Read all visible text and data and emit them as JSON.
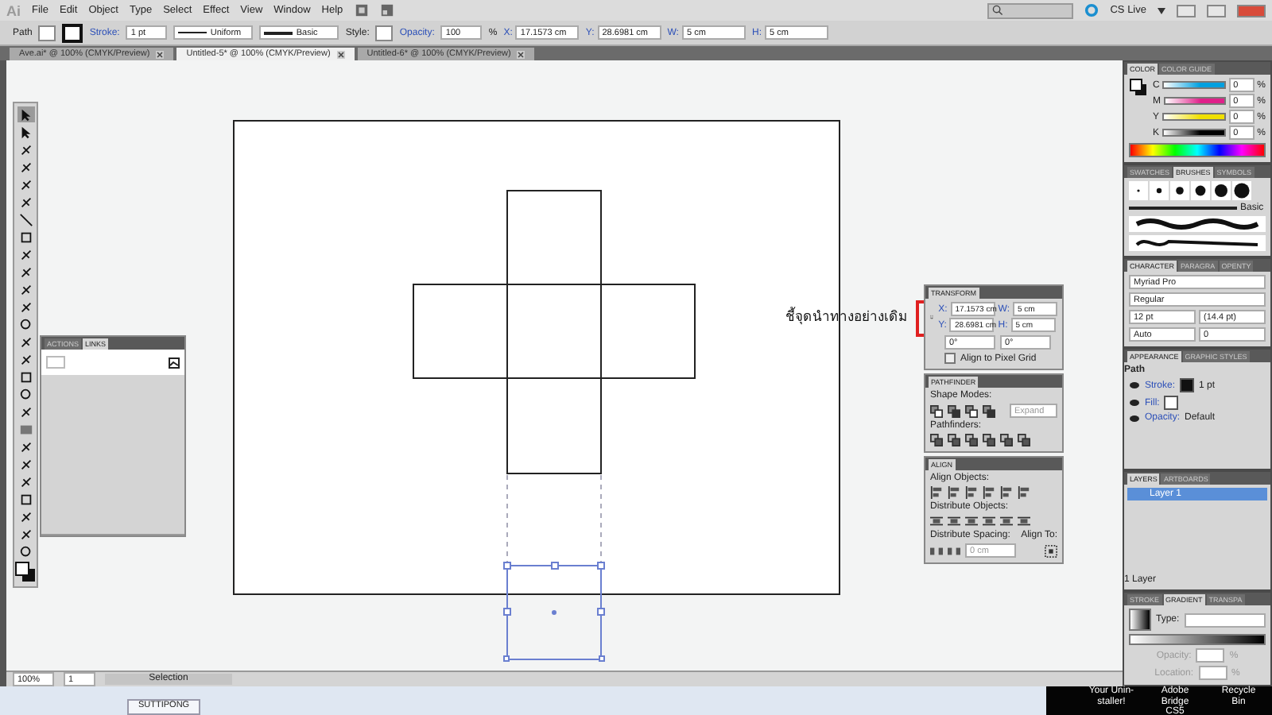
{
  "app": {
    "logo": "Ai",
    "menus": [
      "File",
      "Edit",
      "Object",
      "Type",
      "Select",
      "Effect",
      "View",
      "Window",
      "Help"
    ],
    "cs_live": "CS Live"
  },
  "control_bar": {
    "selection": "Path",
    "stroke_label": "Stroke:",
    "stroke_weight": "1 pt",
    "profile": "Uniform",
    "brush": "Basic",
    "style_label": "Style:",
    "opacity_label": "Opacity:",
    "opacity": "100",
    "percent": "%",
    "fields": [
      {
        "label": "X:",
        "value": "17.1573 cm"
      },
      {
        "label": "Y:",
        "value": "28.6981 cm"
      },
      {
        "label": "W:",
        "value": "5 cm"
      },
      {
        "label": "H:",
        "value": "5 cm"
      }
    ]
  },
  "doc_tabs": [
    {
      "label": "Ave.ai* @ 100% (CMYK/Preview)",
      "selected": false
    },
    {
      "label": "Untitled-5* @ 100% (CMYK/Preview)",
      "selected": true
    },
    {
      "label": "Untitled-6* @ 100% (CMYK/Preview)",
      "selected": false
    }
  ],
  "annotation": "ชี้จุดนำทางอย่างเดิม",
  "links_panel": {
    "tabs": [
      {
        "label": "ACTIONS",
        "selected": false
      },
      {
        "label": "LINKS",
        "selected": true
      }
    ]
  },
  "transform_panel": {
    "title": "TRANSFORM",
    "fields": [
      {
        "label": "X:",
        "value": "17.1573 cm"
      },
      {
        "label": "W:",
        "value": "5 cm"
      },
      {
        "label": "Y:",
        "value": "28.6981 cm"
      },
      {
        "label": "H:",
        "value": "5 cm"
      }
    ],
    "angles": [
      "0°",
      "0°"
    ],
    "pixel_grid": {
      "label": "Align to Pixel Grid",
      "checked": false
    }
  },
  "pathfinder_panel": {
    "title": "PATHFINDER",
    "shape_modes": "Shape Modes:",
    "expand": "Expand",
    "pathfinders": "Pathfinders:"
  },
  "align_panel": {
    "title": "ALIGN",
    "align_objects": "Align Objects:",
    "distribute_objects": "Distribute Objects:",
    "distribute_spacing": "Distribute Spacing:",
    "align_to": "Align To:",
    "spacing": "0 cm"
  },
  "dock": {
    "color": {
      "tabs": [
        {
          "label": "COLOR",
          "selected": true
        },
        {
          "label": "COLOR GUIDE",
          "selected": false
        }
      ],
      "channels": [
        {
          "name": "C",
          "value": "0",
          "color": "#00a0e0"
        },
        {
          "name": "M",
          "value": "0",
          "color": "#e0208a"
        },
        {
          "name": "Y",
          "value": "0",
          "color": "#f0e000"
        },
        {
          "name": "K",
          "value": "0",
          "color": "#000000"
        }
      ],
      "unit": "%"
    },
    "brushes": {
      "tabs": [
        {
          "label": "SWATCHES",
          "selected": false
        },
        {
          "label": "BRUSHES",
          "selected": true
        },
        {
          "label": "SYMBOLS",
          "selected": false
        }
      ],
      "basic": "Basic"
    },
    "character": {
      "tabs": [
        {
          "label": "CHARACTER",
          "selected": true
        },
        {
          "label": "PARAGRA",
          "selected": false
        },
        {
          "label": "OPENTY",
          "selected": false
        }
      ],
      "font": "Myriad Pro",
      "style": "Regular",
      "size": "12 pt",
      "leading": "(14.4 pt)",
      "kerning": "Auto",
      "tracking": "0"
    },
    "appearance": {
      "tabs": [
        {
          "label": "APPEARANCE",
          "selected": true
        },
        {
          "label": "GRAPHIC STYLES",
          "selected": false
        }
      ],
      "object": "Path",
      "rows": [
        {
          "kind": "stroke",
          "label": "Stroke:",
          "value": "1 pt"
        },
        {
          "kind": "fill",
          "label": "Fill:"
        },
        {
          "kind": "opacity",
          "label": "Opacity:",
          "value": "Default"
        }
      ]
    },
    "layers": {
      "tabs": [
        {
          "label": "LAYERS",
          "selected": true
        },
        {
          "label": "ARTBOARDS",
          "selected": false
        }
      ],
      "items": [
        {
          "name": "Layer 1",
          "selected": true
        }
      ],
      "count": "1 Layer"
    },
    "gradient": {
      "tabs": [
        {
          "label": "STROKE",
          "selected": false
        },
        {
          "label": "GRADIENT",
          "selected": true
        },
        {
          "label": "TRANSPA",
          "selected": false
        }
      ],
      "type_label": "Type:",
      "opacity_label": "Opacity:",
      "location_label": "Location:",
      "unit": "%"
    }
  },
  "status_bar": {
    "zoom": "100%",
    "artboard": "1",
    "tool": "Selection"
  },
  "taskbar": {
    "items": [
      "SUTTIPONG"
    ],
    "desktop": [
      "Your Unin-staller!",
      "Adobe Bridge CS5",
      "Recycle Bin"
    ]
  }
}
